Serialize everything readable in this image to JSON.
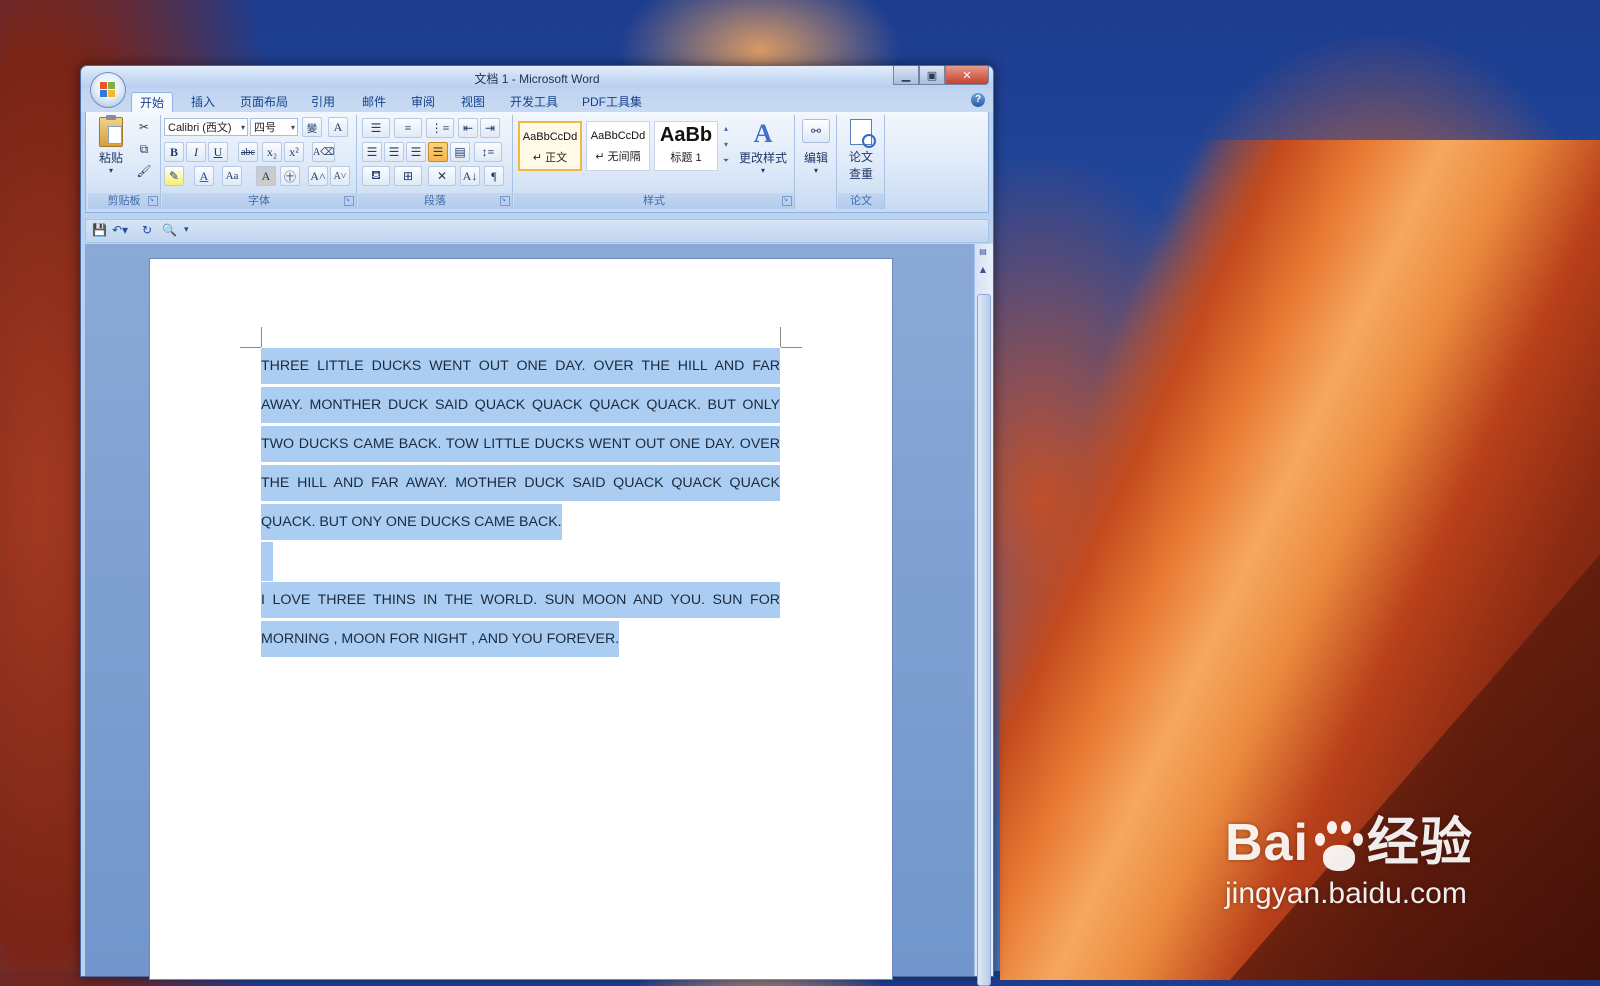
{
  "window": {
    "title": "文档 1 - Microsoft Word",
    "minimize_icon": "minimize-icon",
    "maximize_icon": "maximize-icon",
    "close_icon": "close-icon"
  },
  "tabs": [
    {
      "label": "开始",
      "active": true
    },
    {
      "label": "插入"
    },
    {
      "label": "页面布局"
    },
    {
      "label": "引用"
    },
    {
      "label": "邮件"
    },
    {
      "label": "审阅"
    },
    {
      "label": "视图"
    },
    {
      "label": "开发工具"
    },
    {
      "label": "PDF工具集"
    }
  ],
  "ribbon": {
    "clipboard": {
      "label": "剪贴板",
      "paste": "粘贴"
    },
    "font": {
      "label": "字体",
      "font_name": "Calibri (西文)",
      "font_size": "四号",
      "bold": "B",
      "italic": "I",
      "underline": "U",
      "strike": "abc",
      "subscript": "x₂",
      "superscript": "x²",
      "font_color": "A",
      "case": "Aa"
    },
    "paragraph": {
      "label": "段落"
    },
    "styles": {
      "label": "样式",
      "items": [
        {
          "sample": "AaBbCcDd",
          "name": "↵ 正文"
        },
        {
          "sample": "AaBbCcDd",
          "name": "↵ 无间隔"
        },
        {
          "sample": "AaBb",
          "name": "标题 1"
        }
      ],
      "change_styles": "更改样式"
    },
    "editing": {
      "label": "编辑"
    },
    "thesis": {
      "label": "论文",
      "check": "论文",
      "check2": "查重"
    }
  },
  "document": {
    "paragraphs": [
      "THREE LITTLE DUCKS WENT OUT ONE DAY. OVER THE HILL AND FAR AWAY. MONTHER DUCK SAID QUACK QUACK QUACK QUACK. BUT ONLY TWO DUCKS CAME BACK. TOW LITTLE DUCKS WENT OUT ONE DAY. OVER THE HILL AND FAR AWAY. MOTHER DUCK SAID QUACK QUACK QUACK QUACK. BUT ONY ONE DUCKS CAME BACK.",
      "",
      "I LOVE THREE THINS IN THE WORLD. SUN MOON AND YOU. SUN FOR MORNING , MOON FOR NIGHT , AND YOU FOREVER."
    ]
  },
  "watermark": {
    "brand": "Bai",
    "brand2": "经验",
    "url": "jingyan.baidu.com"
  },
  "colors": {
    "selection": "#aacdf1",
    "ribbon_text": "#15428b"
  }
}
